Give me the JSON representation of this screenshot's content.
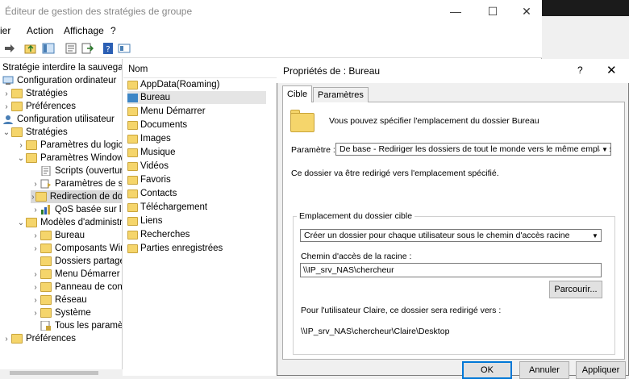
{
  "window": {
    "title": "Éditeur de gestion des stratégies de groupe",
    "controls": {
      "minimize": "—",
      "maximize": "☐",
      "close": "✕"
    }
  },
  "menubar": [
    "ier",
    "Action",
    "Affichage",
    "?"
  ],
  "tree": {
    "items": [
      {
        "label": "Stratégie interdire la sauvegarde"
      },
      {
        "label": "Configuration ordinateur"
      },
      {
        "label": "Stratégies"
      },
      {
        "label": "Préférences"
      },
      {
        "label": "Configuration utilisateur"
      },
      {
        "label": "Stratégies"
      },
      {
        "label": "Paramètres du logiciel"
      },
      {
        "label": "Paramètres Windows"
      },
      {
        "label": "Scripts (ouverture"
      },
      {
        "label": "Paramètres de sé"
      },
      {
        "label": "Redirection de do"
      },
      {
        "label": "QoS basée sur la"
      },
      {
        "label": "Modèles d'administr"
      },
      {
        "label": "Bureau"
      },
      {
        "label": "Composants Win"
      },
      {
        "label": "Dossiers partagés"
      },
      {
        "label": "Menu Démarrer e"
      },
      {
        "label": "Panneau de conf"
      },
      {
        "label": "Réseau"
      },
      {
        "label": "Système"
      },
      {
        "label": "Tous les paramètr"
      },
      {
        "label": "Préférences"
      }
    ]
  },
  "list": {
    "header": "Nom",
    "items": [
      "AppData(Roaming)",
      "Bureau",
      "Menu Démarrer",
      "Documents",
      "Images",
      "Musique",
      "Vidéos",
      "Favoris",
      "Contacts",
      "Téléchargement",
      "Liens",
      "Recherches",
      "Parties enregistrées"
    ]
  },
  "dialog": {
    "title": "Propriétés de : Bureau",
    "help": "?",
    "close": "✕",
    "tabs": [
      "Cible",
      "Paramètres"
    ],
    "intro": "Vous pouvez spécifier l'emplacement du dossier Bureau",
    "setting_label": "Paramètre :",
    "setting_value": "De base - Rediriger les dossiers de tout le monde vers le même emplacement",
    "redirect_note": "Ce dossier va être redirigé vers l'emplacement spécifié.",
    "group_label": "Emplacement du dossier cible",
    "target_option": "Créer un dossier pour chaque utilisateur sous le chemin d'accès racine",
    "root_label": "Chemin d'accès de la racine :",
    "root_value": "\\\\IP_srv_NAS\\chercheur",
    "browse": "Parcourir...",
    "user_note": "Pour l'utilisateur Claire, ce dossier sera redirigé vers :",
    "user_path": "\\\\IP_srv_NAS\\chercheur\\Claire\\Desktop",
    "buttons": {
      "ok": "OK",
      "cancel": "Annuler",
      "apply": "Appliquer"
    }
  },
  "colors": {
    "accent": "#0078d7",
    "folder": "#f5d56b",
    "selection": "#d9d9d9"
  }
}
